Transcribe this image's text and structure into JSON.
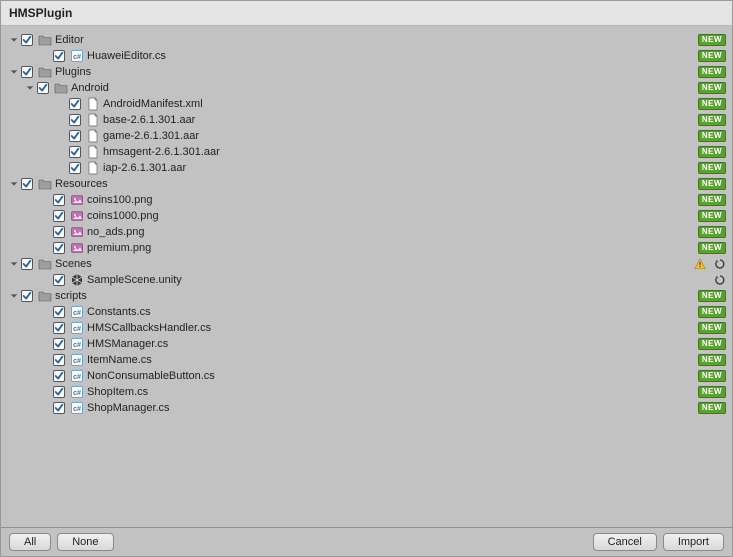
{
  "window": {
    "title": "HMSPlugin"
  },
  "badges": {
    "new": "NEW"
  },
  "footer": {
    "all_label": "All",
    "none_label": "None",
    "cancel_label": "Cancel",
    "import_label": "Import"
  },
  "tree": [
    {
      "indent": 0,
      "expand": "down",
      "checked": true,
      "icon": "folder",
      "label": "Editor",
      "right": "new"
    },
    {
      "indent": 2,
      "expand": null,
      "checked": true,
      "icon": "cs",
      "label": "HuaweiEditor.cs",
      "right": "new"
    },
    {
      "indent": 0,
      "expand": "down",
      "checked": true,
      "icon": "folder",
      "label": "Plugins",
      "right": "new"
    },
    {
      "indent": 1,
      "expand": "down",
      "checked": true,
      "icon": "folder",
      "label": "Android",
      "right": "new"
    },
    {
      "indent": 3,
      "expand": null,
      "checked": true,
      "icon": "file",
      "label": "AndroidManifest.xml",
      "right": "new"
    },
    {
      "indent": 3,
      "expand": null,
      "checked": true,
      "icon": "file",
      "label": "base-2.6.1.301.aar",
      "right": "new"
    },
    {
      "indent": 3,
      "expand": null,
      "checked": true,
      "icon": "file",
      "label": "game-2.6.1.301.aar",
      "right": "new"
    },
    {
      "indent": 3,
      "expand": null,
      "checked": true,
      "icon": "file",
      "label": "hmsagent-2.6.1.301.aar",
      "right": "new"
    },
    {
      "indent": 3,
      "expand": null,
      "checked": true,
      "icon": "file",
      "label": "iap-2.6.1.301.aar",
      "right": "new"
    },
    {
      "indent": 0,
      "expand": "down",
      "checked": true,
      "icon": "folder",
      "label": "Resources",
      "right": "new"
    },
    {
      "indent": 2,
      "expand": null,
      "checked": true,
      "icon": "image",
      "label": "coins100.png",
      "right": "new"
    },
    {
      "indent": 2,
      "expand": null,
      "checked": true,
      "icon": "image",
      "label": "coins1000.png",
      "right": "new"
    },
    {
      "indent": 2,
      "expand": null,
      "checked": true,
      "icon": "image",
      "label": "no_ads.png",
      "right": "new"
    },
    {
      "indent": 2,
      "expand": null,
      "checked": true,
      "icon": "image",
      "label": "premium.png",
      "right": "new"
    },
    {
      "indent": 0,
      "expand": "down",
      "checked": true,
      "icon": "folder",
      "label": "Scenes",
      "right": "warn-refresh"
    },
    {
      "indent": 2,
      "expand": null,
      "checked": true,
      "icon": "unity",
      "label": "SampleScene.unity",
      "right": "refresh"
    },
    {
      "indent": 0,
      "expand": "down",
      "checked": true,
      "icon": "folder",
      "label": "scripts",
      "right": "new"
    },
    {
      "indent": 2,
      "expand": null,
      "checked": true,
      "icon": "cs",
      "label": "Constants.cs",
      "right": "new"
    },
    {
      "indent": 2,
      "expand": null,
      "checked": true,
      "icon": "cs",
      "label": "HMSCallbacksHandler.cs",
      "right": "new"
    },
    {
      "indent": 2,
      "expand": null,
      "checked": true,
      "icon": "cs",
      "label": "HMSManager.cs",
      "right": "new"
    },
    {
      "indent": 2,
      "expand": null,
      "checked": true,
      "icon": "cs",
      "label": "ItemName.cs",
      "right": "new"
    },
    {
      "indent": 2,
      "expand": null,
      "checked": true,
      "icon": "cs",
      "label": "NonConsumableButton.cs",
      "right": "new"
    },
    {
      "indent": 2,
      "expand": null,
      "checked": true,
      "icon": "cs",
      "label": "ShopItem.cs",
      "right": "new"
    },
    {
      "indent": 2,
      "expand": null,
      "checked": true,
      "icon": "cs",
      "label": "ShopManager.cs",
      "right": "new"
    }
  ]
}
